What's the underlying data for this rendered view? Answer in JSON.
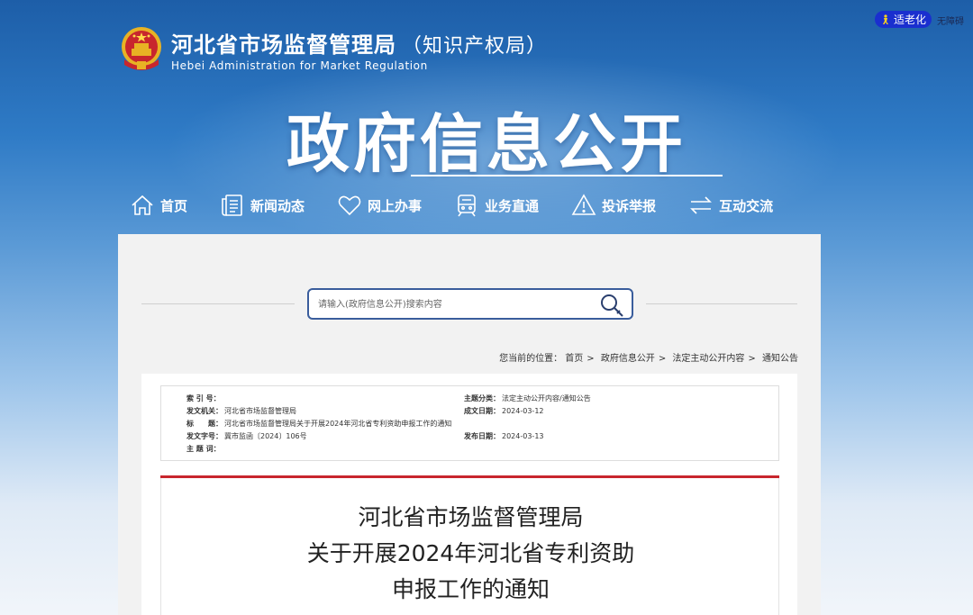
{
  "accessibility": {
    "elder_mode": "适老化",
    "barrier_free": "无障碍"
  },
  "header": {
    "title": "河北省市场监督管理局",
    "subtitle": "（知识产权局）",
    "english": "Hebei Administration for Market Regulation",
    "banner_title": "政府信息公开"
  },
  "nav": {
    "items": [
      {
        "label": "首页",
        "icon": "home-icon"
      },
      {
        "label": "新闻动态",
        "icon": "news-icon"
      },
      {
        "label": "网上办事",
        "icon": "heart-icon"
      },
      {
        "label": "业务直通",
        "icon": "train-icon"
      },
      {
        "label": "投诉举报",
        "icon": "warning-icon"
      },
      {
        "label": "互动交流",
        "icon": "exchange-icon"
      }
    ]
  },
  "search": {
    "placeholder": "请输入(政府信息公开)搜索内容"
  },
  "breadcrumb": {
    "prefix": "您当前的位置：",
    "items": [
      "首页",
      "政府信息公开",
      "法定主动公开内容",
      "通知公告"
    ],
    "sep": ">"
  },
  "meta": {
    "index_no_label": "索 引 号：",
    "index_no": "",
    "issuer_label": "发文机关：",
    "issuer": "河北省市场监督管理局",
    "title_label": "标　　题：",
    "title": "河北省市场监督管理局关于开展2024年河北省专利资助申报工作的通知",
    "doc_no_label": "发文字号：",
    "doc_no": "冀市监函〔2024〕106号",
    "keywords_label": "主 题 词：",
    "keywords": "",
    "category_label": "主题分类：",
    "category": "法定主动公开内容/通知公告",
    "created_label": "成文日期：",
    "created": "2024-03-12",
    "published_label": "发布日期：",
    "published": "2024-03-13"
  },
  "document": {
    "title_lines": [
      "河北省市场监督管理局",
      "关于开展2024年河北省专利资助",
      "申报工作的通知"
    ]
  },
  "colors": {
    "accent_red": "#c8262d",
    "elder_btn": "#1a2fcf",
    "search_border": "#3a5d9c"
  }
}
